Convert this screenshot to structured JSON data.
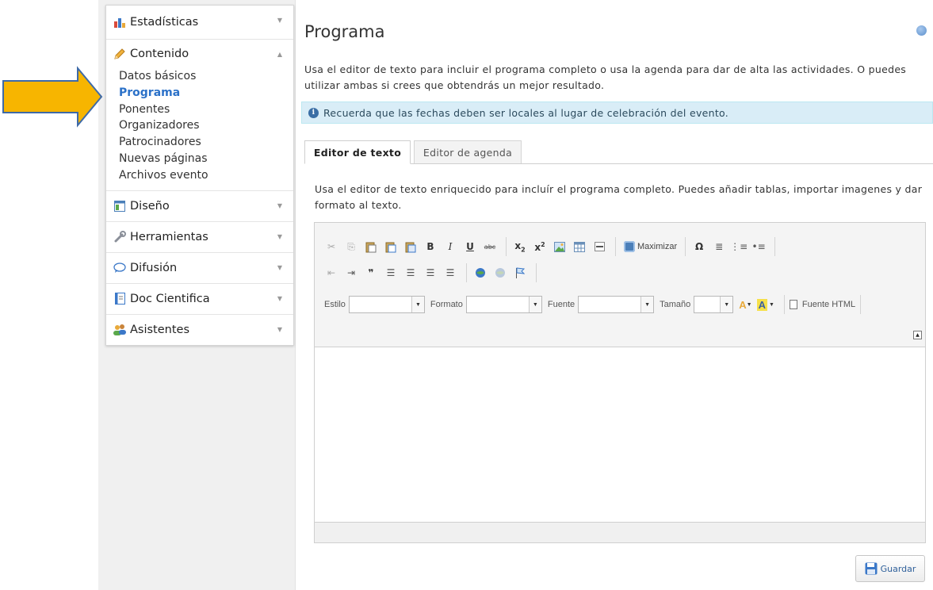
{
  "sidebar": {
    "sections": [
      {
        "label": "Estadísticas"
      },
      {
        "label": "Contenido"
      },
      {
        "label": "Diseño"
      },
      {
        "label": "Herramientas"
      },
      {
        "label": "Difusión"
      },
      {
        "label": "Doc Cientifica"
      },
      {
        "label": "Asistentes"
      }
    ],
    "content_items": [
      "Datos básicos",
      "Programa",
      "Ponentes",
      "Organizadores",
      "Patrocinadores",
      "Nuevas páginas",
      "Archivos evento"
    ],
    "active_item": "Programa"
  },
  "main": {
    "title": "Programa",
    "intro": "Usa el editor de texto para incluir el programa completo o usa la agenda para dar de alta las actividades. O puedes utilizar ambas si crees que obtendrás un mejor resultado.",
    "alert": "Recuerda que las fechas deben ser locales al lugar de celebración del evento.",
    "tabs": [
      {
        "label": "Editor de texto",
        "active": true
      },
      {
        "label": "Editor de agenda",
        "active": false
      }
    ],
    "description": "Usa el editor de texto enriquecido para incluír el programa completo. Puedes añadir tablas, importar imagenes y dar formato al texto."
  },
  "editor": {
    "maximize_label": "Maximizar",
    "combos": {
      "style": "Estilo",
      "format": "Formato",
      "font": "Fuente",
      "size": "Tamaño"
    },
    "source_label": "Fuente HTML"
  },
  "save_label": "Guardar",
  "colors": {
    "accent": "#2b71c8",
    "alert_bg": "#d9edf7",
    "arrow_fill": "#f7b500",
    "arrow_stroke": "#3e6aa8"
  }
}
